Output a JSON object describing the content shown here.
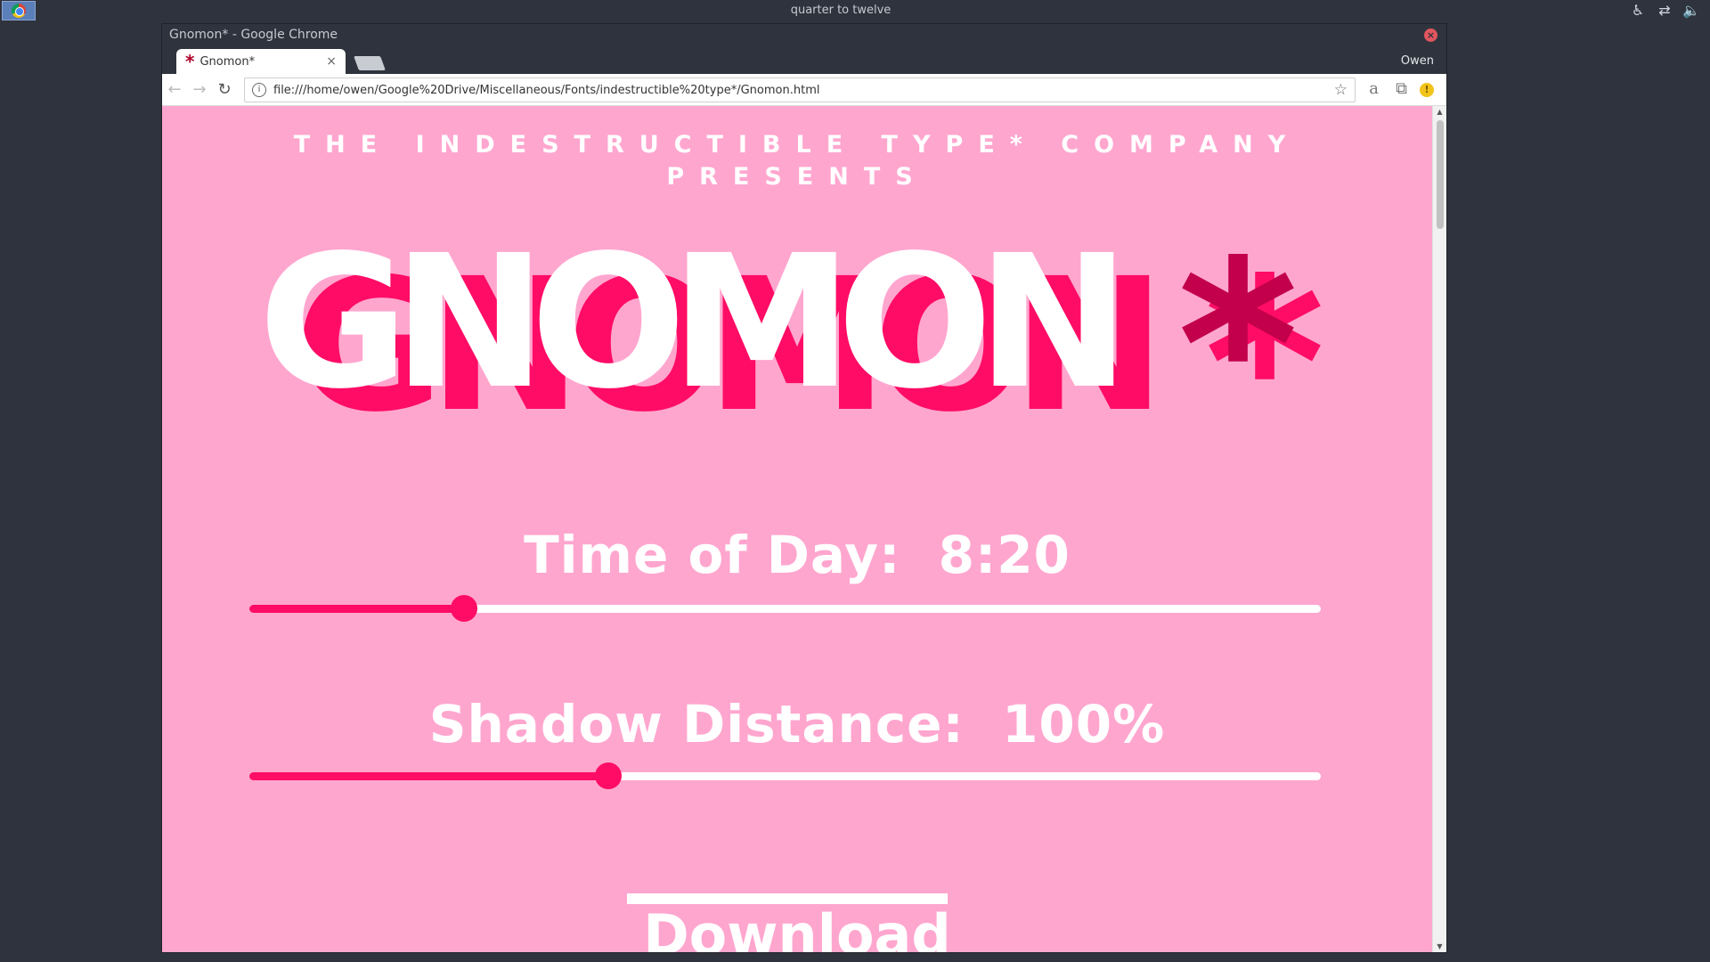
{
  "panel": {
    "clock": "quarter to twelve",
    "launcher_icon": "chrome-icon",
    "tray_icons": [
      "accessibility-icon",
      "network-icon",
      "volume-icon"
    ]
  },
  "window": {
    "title": "Gnomon* - Google Chrome",
    "profile": "Owen"
  },
  "tab": {
    "label": "Gnomon*",
    "close": "×"
  },
  "toolbar": {
    "url": "file:///home/owen/Google%20Drive/Miscellaneous/Fonts/indestructible%20type*/Gnomon.html"
  },
  "page": {
    "presents_line1": "THE INDESTRUCTIBLE TYPE* COMPANY",
    "presents_line2": "PRESENTS",
    "logo": "GNOMON",
    "asterisk": "*",
    "time_label": "Time of Day:  8:20",
    "time_value_fraction": 0.2,
    "shadow_label": "Shadow Distance:  100%",
    "shadow_value_fraction": 0.335,
    "download": "Download"
  },
  "colors": {
    "background": "#ffa6cf",
    "accent": "#ff0c66",
    "asterisk": "#c2004b",
    "text": "#ffffff"
  }
}
